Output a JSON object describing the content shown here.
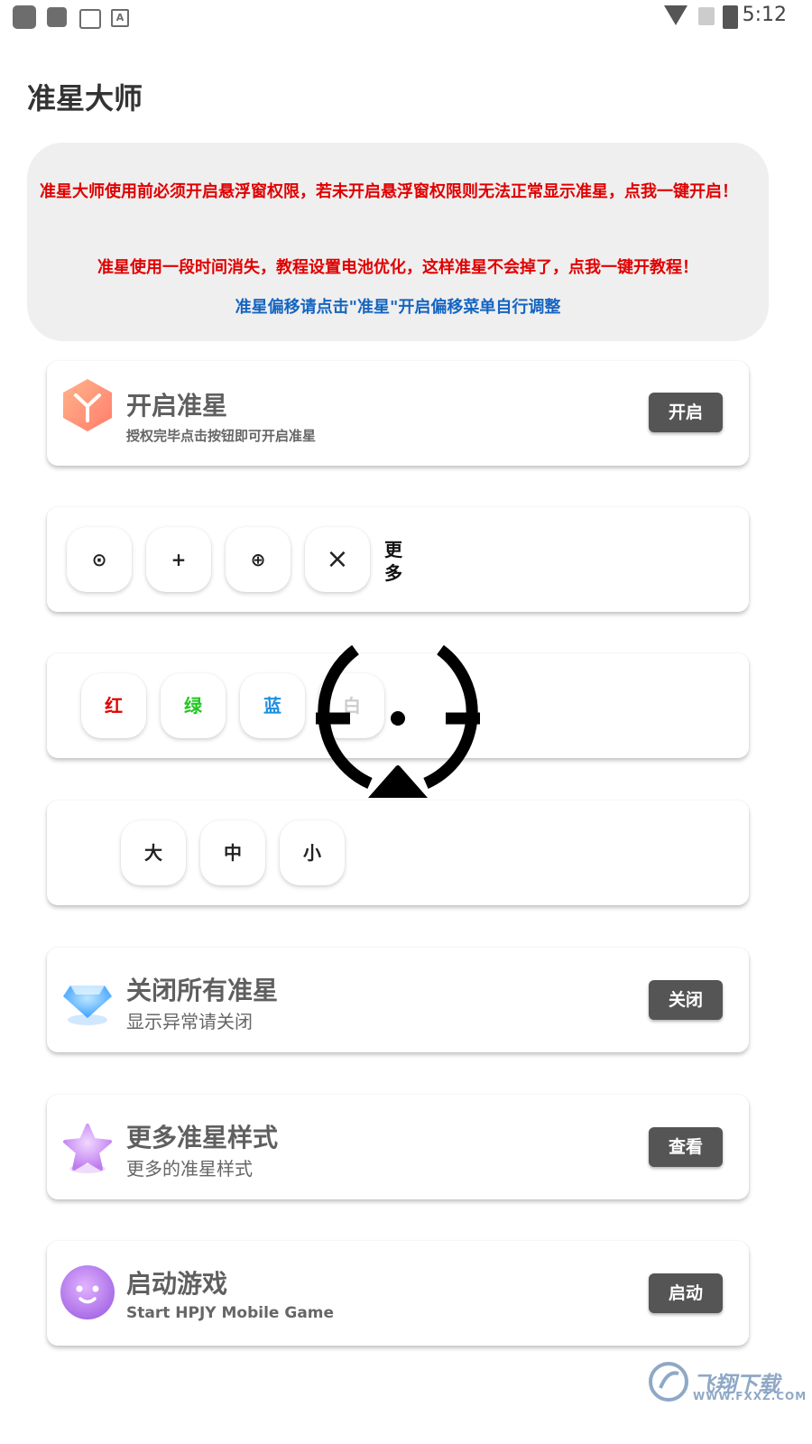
{
  "status_bar": {
    "time": "5:12",
    "icons": [
      "notification-icon",
      "notification-icon",
      "image-icon",
      "font-icon",
      "wifi-icon",
      "no-sim-icon",
      "battery-charging-icon"
    ]
  },
  "app": {
    "title": "准星大师"
  },
  "notice": {
    "line1": "准星大师使用前必须开启悬浮窗权限，若未开启悬浮窗权限则无法正常显示准星，点我一键开启！",
    "line2": "准星使用一段时间消失，教程设置电池优化，这样准星不会掉了，点我一键开教程！",
    "line3": "准星偏移请点击\"准星\"开启偏移菜单自行调整"
  },
  "enable_card": {
    "title": "开启准星",
    "subtitle": "授权完毕点击按钮即可开启准星",
    "button": "开启",
    "icon": "cube-icon"
  },
  "style_row": {
    "options": [
      "⊙",
      "+",
      "⊕",
      "×"
    ],
    "more_label": "更多"
  },
  "color_row": {
    "options": [
      {
        "label": "红",
        "color": "#e00000"
      },
      {
        "label": "绿",
        "color": "#1ec81e"
      },
      {
        "label": "蓝",
        "color": "#1e8fe0"
      },
      {
        "label": "白",
        "color": "#cccccc"
      }
    ]
  },
  "size_row": {
    "options": [
      "大",
      "中",
      "小"
    ]
  },
  "close_card": {
    "title": "关闭所有准星",
    "subtitle": "显示异常请关闭",
    "button": "关闭",
    "icon": "diamond-icon"
  },
  "styles_card": {
    "title": "更多准星样式",
    "subtitle": "更多的准星样式",
    "button": "查看",
    "icon": "star-icon"
  },
  "launch_card": {
    "title": "启动游戏",
    "subtitle": "Start HPJY Mobile Game",
    "button": "启动",
    "icon": "smiley-icon"
  },
  "watermark": {
    "text": "飞翔下载",
    "url": "WWW.FXXZ.COM"
  }
}
